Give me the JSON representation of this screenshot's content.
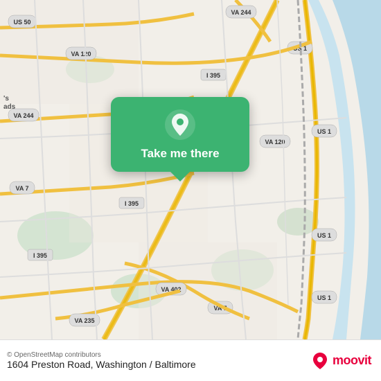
{
  "map": {
    "background_color": "#f2efe9",
    "center_lat": 38.83,
    "center_lng": -77.07
  },
  "popup": {
    "button_label": "Take me there",
    "bg_color": "#3cb371"
  },
  "bottom_bar": {
    "attribution": "© OpenStreetMap contributors",
    "address": "1604 Preston Road, Washington / Baltimore",
    "moovit_label": "moovit"
  }
}
